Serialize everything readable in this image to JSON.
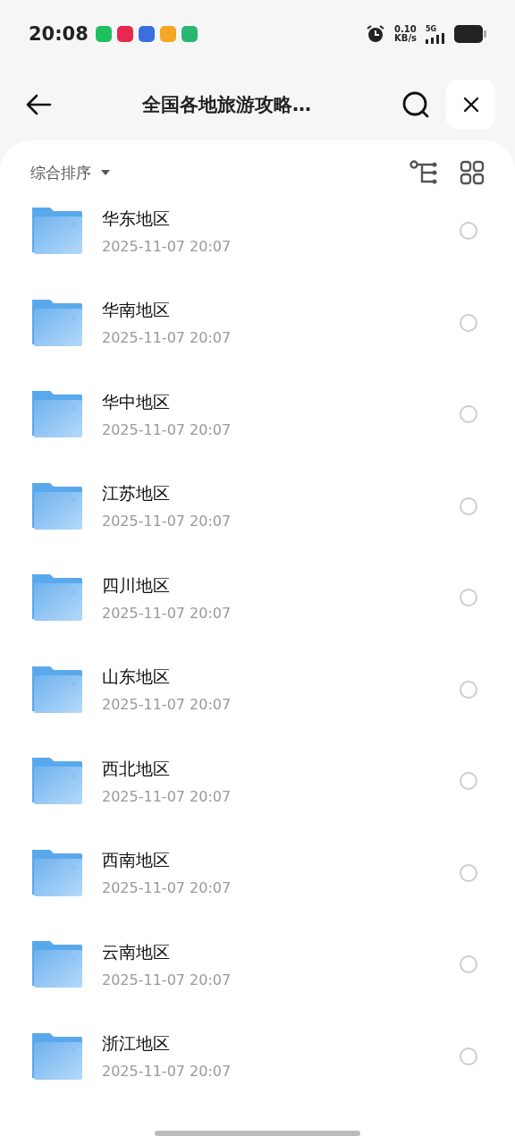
{
  "status_bar": {
    "time": "20:08",
    "app_icons": [
      {
        "color": "#1fc15f"
      },
      {
        "color": "#e8284f"
      },
      {
        "color": "#3b6fe0"
      },
      {
        "color": "#f5a623"
      },
      {
        "color": "#2bb673"
      }
    ],
    "net_speed": "0.10",
    "net_unit": "KB/s",
    "network": "5G"
  },
  "nav": {
    "title": "全国各地旅游攻略…"
  },
  "toolbar": {
    "sort_label": "综合排序"
  },
  "folders": [
    {
      "name": "华东地区",
      "date": "2025-11-07 20:07",
      "selected": false
    },
    {
      "name": "华南地区",
      "date": "2025-11-07 20:07",
      "selected": false
    },
    {
      "name": "华中地区",
      "date": "2025-11-07 20:07",
      "selected": false
    },
    {
      "name": "江苏地区",
      "date": "2025-11-07 20:07",
      "selected": false
    },
    {
      "name": "四川地区",
      "date": "2025-11-07 20:07",
      "selected": false
    },
    {
      "name": "山东地区",
      "date": "2025-11-07 20:07",
      "selected": false
    },
    {
      "name": "西北地区",
      "date": "2025-11-07 20:07",
      "selected": false
    },
    {
      "name": "西南地区",
      "date": "2025-11-07 20:07",
      "selected": false
    },
    {
      "name": "云南地区",
      "date": "2025-11-07 20:07",
      "selected": false
    },
    {
      "name": "浙江地区",
      "date": "2025-11-07 20:07",
      "selected": false
    }
  ]
}
